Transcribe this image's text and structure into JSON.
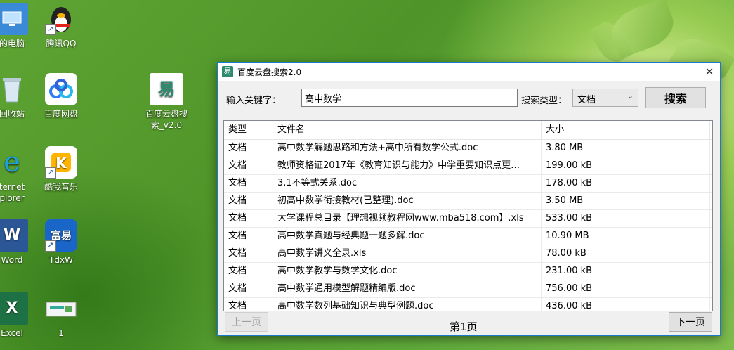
{
  "desktop": {
    "icons": [
      {
        "label": "的电脑"
      },
      {
        "label": "腾讯QQ"
      },
      {
        "label": "回收站"
      },
      {
        "label": "百度网盘"
      },
      {
        "label": "百度云盘搜\n索_v2.0"
      },
      {
        "label": "ternet\nplorer"
      },
      {
        "label": "酷我音乐"
      },
      {
        "label": "Word"
      },
      {
        "label": "TdxW"
      },
      {
        "label": "Excel"
      },
      {
        "label": "1"
      }
    ]
  },
  "window": {
    "title": "百度云盘搜索2.0",
    "close_glyph": "✕",
    "keyword_label": "输入关键字：",
    "keyword_value": "高中数学",
    "type_label": "搜索类型：",
    "type_value": "文档",
    "search_button": "搜索"
  },
  "table": {
    "headers": [
      "类型",
      "文件名",
      "大小"
    ],
    "rows": [
      [
        "文档",
        "高中数学解题思路和方法+高中所有数学公式.doc",
        "3.80 MB"
      ],
      [
        "文档",
        "教师资格证2017年《教育知识与能力》中学重要知识点更…",
        "199.00 kB"
      ],
      [
        "文档",
        "3.1不等式关系.doc",
        "178.00 kB"
      ],
      [
        "文档",
        "初高中数学衔接教材(已整理).doc",
        "3.50 MB"
      ],
      [
        "文档",
        "大学课程总目录【理想视频教程网www.mba518.com】.xls",
        "533.00 kB"
      ],
      [
        "文档",
        "高中数学真题与经典题一题多解.doc",
        "10.90 MB"
      ],
      [
        "文档",
        "高中数学讲义全录.xls",
        "78.00 kB"
      ],
      [
        "文档",
        "高中数学教学与数学文化.doc",
        "231.00 kB"
      ],
      [
        "文档",
        "高中数学通用模型解题精编版.doc",
        "756.00 kB"
      ],
      [
        "文档",
        "高中数学数列基础知识与典型例题.doc",
        "436.00 kB"
      ]
    ]
  },
  "footer": {
    "prev_label": "上一页",
    "page_label": "第1页",
    "next_label": "下一页"
  }
}
